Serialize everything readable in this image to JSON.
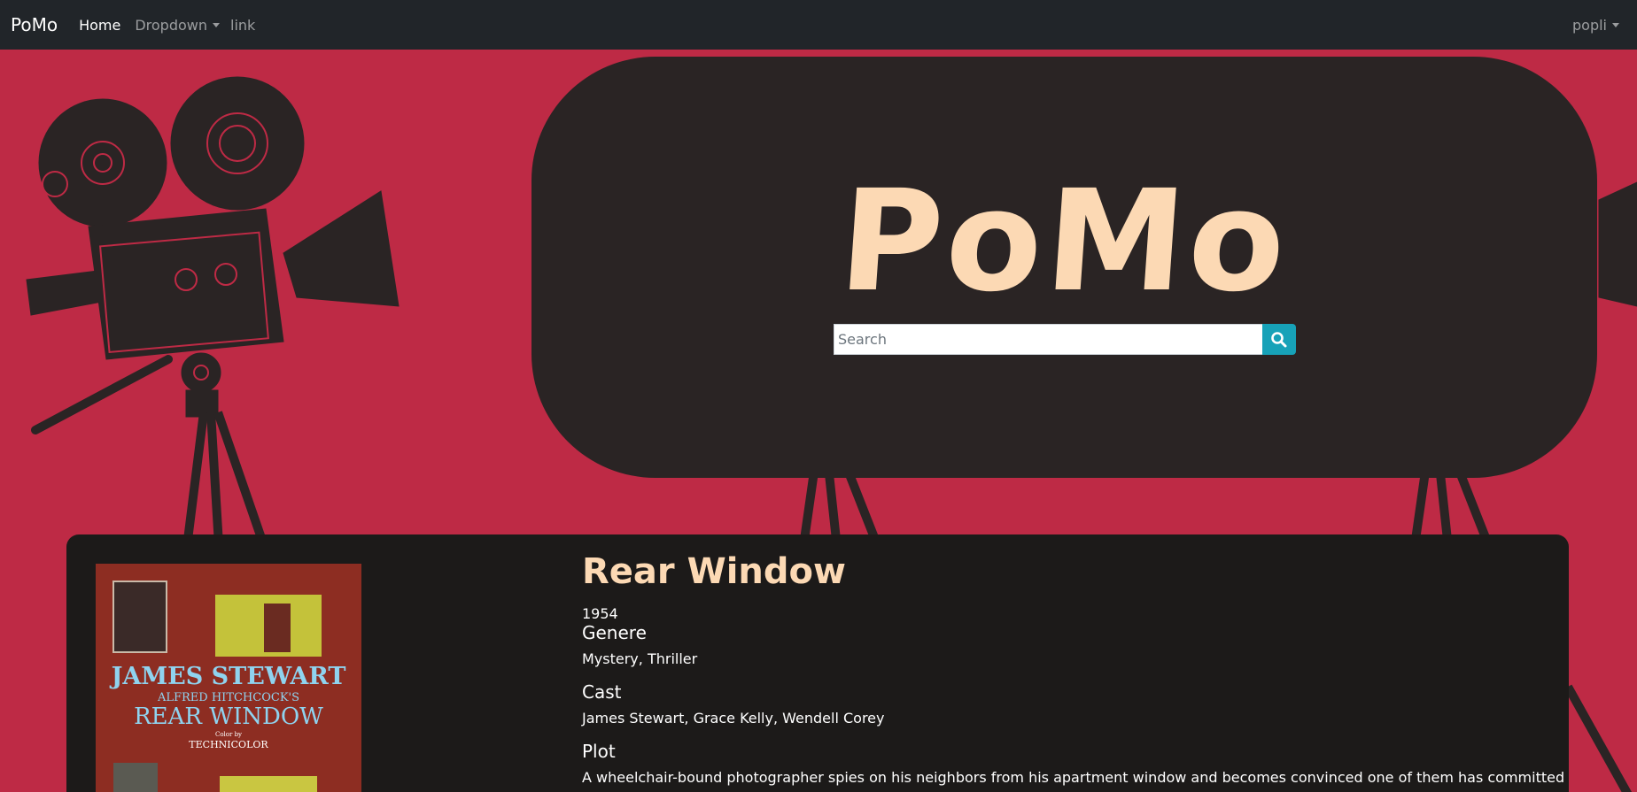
{
  "navbar": {
    "brand": "PoMo",
    "links": [
      {
        "label": "Home"
      },
      {
        "label": "Dropdown"
      },
      {
        "label": "link"
      }
    ],
    "user": "popli"
  },
  "hero": {
    "title": "PoMo",
    "search": {
      "placeholder": "Search",
      "value": ""
    }
  },
  "movie": {
    "title": "Rear Window",
    "year": "1954",
    "genre_label": "Genere",
    "genre": "Mystery, Thriller",
    "cast_label": "Cast",
    "cast": "James Stewart, Grace Kelly, Wendell Corey",
    "plot_label": "Plot",
    "plot": "A wheelchair-bound photographer spies on his neighbors from his apartment window and becomes convinced one of them has committed",
    "poster": {
      "line1": "JAMES STEWART",
      "line2": "ALFRED HITCHCOCK'S",
      "line3": "REAR WINDOW",
      "line4": "Color by",
      "line5": "TECHNICOLOR"
    }
  },
  "colors": {
    "background": "#be2a45",
    "navbar": "#212529",
    "hero": "#2a2424",
    "accent": "#fcd9b4",
    "search_button": "#17a2b8"
  }
}
